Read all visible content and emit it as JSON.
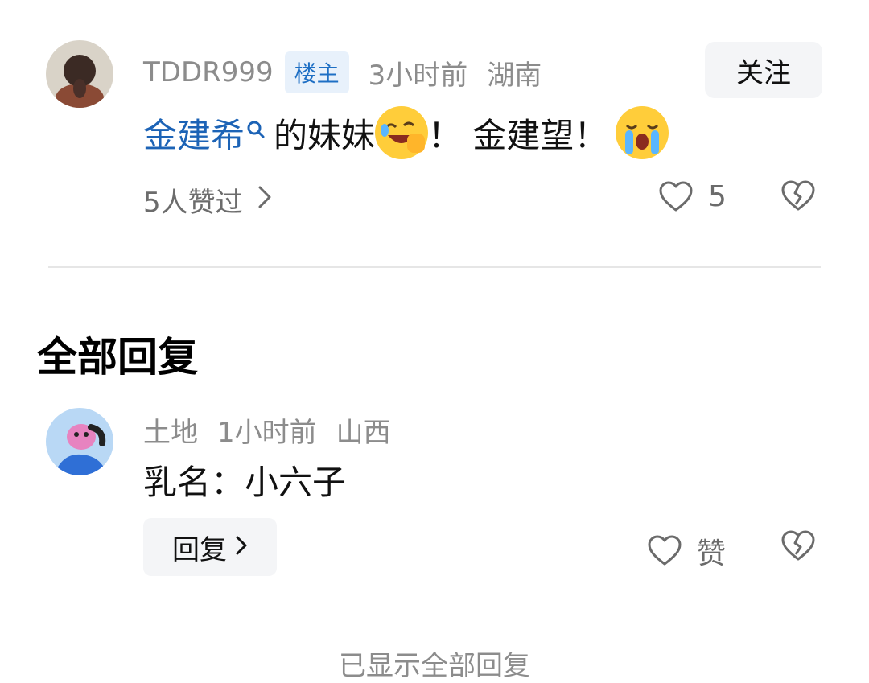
{
  "main_comment": {
    "username": "TDDR999",
    "op_badge": "楼主",
    "time": "3小时前",
    "location": "湖南",
    "follow_label": "关注",
    "text_link": "金建希",
    "text_part1": " 的妹妹",
    "text_part2": "！ 金建望！ ",
    "likers_label": "5人赞过",
    "like_count": "5"
  },
  "section": {
    "title": "全部回复"
  },
  "reply": {
    "username": "土地",
    "time": "1小时前",
    "location": "山西",
    "text": "乳名：小六子",
    "reply_label": "回复",
    "like_label": "赞"
  },
  "footer": {
    "text": "已显示全部回复"
  },
  "colors": {
    "link": "#1c63b6",
    "badge_bg": "#e8f1fb",
    "badge_text": "#1e6fc4",
    "muted": "#8c8c8c"
  },
  "icons": {
    "search": "search-icon",
    "chevron": "chevron-right-icon",
    "like": "heart-icon",
    "dislike": "broken-heart-icon",
    "emoji_laugh": "laughing-emoji-icon",
    "emoji_cry": "crying-emoji-icon"
  }
}
